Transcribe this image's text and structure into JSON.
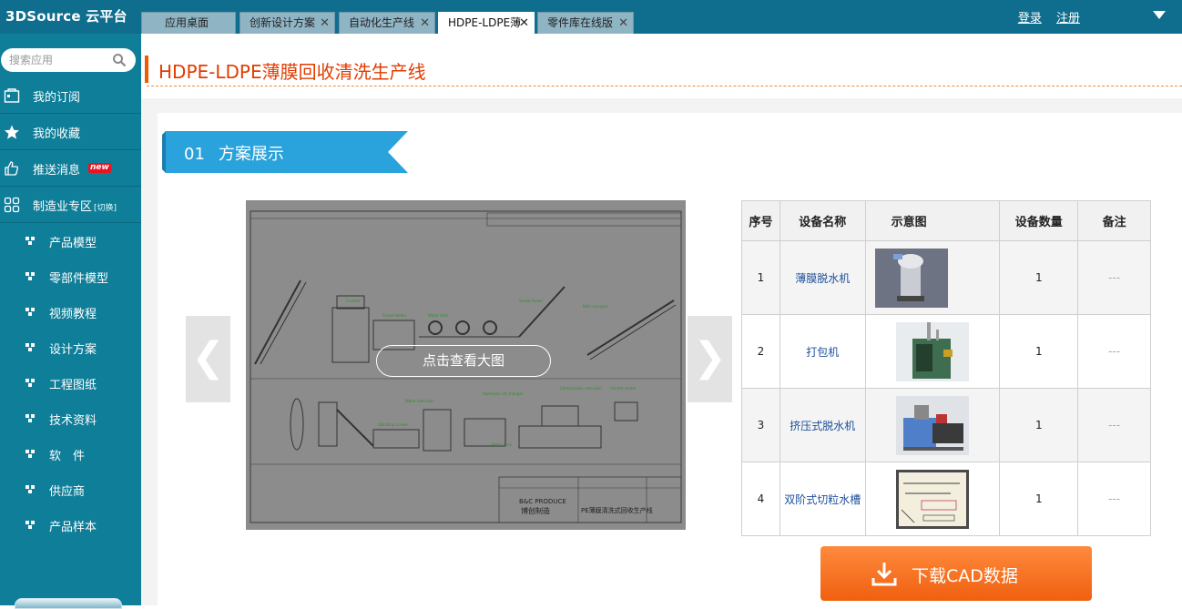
{
  "app": {
    "logo": "3DSource 云平台"
  },
  "tabs": [
    {
      "label": "应用桌面",
      "closable": false,
      "active": false
    },
    {
      "label": "创新设计方案",
      "closable": true,
      "active": false
    },
    {
      "label": "自动化生产线",
      "closable": true,
      "active": false
    },
    {
      "label": "HDPE-LDPE薄",
      "closable": true,
      "active": true
    },
    {
      "label": "零件库在线版",
      "closable": true,
      "active": false
    }
  ],
  "auth": {
    "login": "登录",
    "register": "注册"
  },
  "sidebar": {
    "search_placeholder": "搜索应用",
    "menu": [
      {
        "label": "我的订阅",
        "icon": "subscription-icon"
      },
      {
        "label": "我的收藏",
        "icon": "star-icon"
      },
      {
        "label": "推送消息",
        "icon": "thumbs-up-icon",
        "badge": "new"
      },
      {
        "label": "制造业专区",
        "icon": "grid-icon",
        "suffix": "[切换]"
      }
    ],
    "subitems": [
      "产品模型",
      "零部件模型",
      "视频教程",
      "设计方案",
      "工程图纸",
      "技术资料",
      "软　件",
      "供应商",
      "产品样本"
    ]
  },
  "page": {
    "title": "HDPE-LDPE薄膜回收清洗生产线",
    "section_number": "01",
    "section_title": "方案展示",
    "preview_button": "点击查看大图",
    "prev_arrow": "❮",
    "next_arrow": "❯",
    "download_label": "下载CAD数据"
  },
  "drawing": {
    "company_en": "B&C PRODUCE",
    "company_cn": "博创制造",
    "drawing_title": "PE薄膜清洗式回收生产线"
  },
  "table": {
    "headers": [
      "序号",
      "设备名称",
      "示意图",
      "设备数量",
      "备注"
    ],
    "rows": [
      {
        "no": "1",
        "name": "薄膜脱水机",
        "qty": "1",
        "remark": "---"
      },
      {
        "no": "2",
        "name": "打包机",
        "qty": "1",
        "remark": "---"
      },
      {
        "no": "3",
        "name": "挤压式脱水机",
        "qty": "1",
        "remark": "---"
      },
      {
        "no": "4",
        "name": "双阶式切粒水槽",
        "qty": "1",
        "remark": "---"
      }
    ]
  }
}
